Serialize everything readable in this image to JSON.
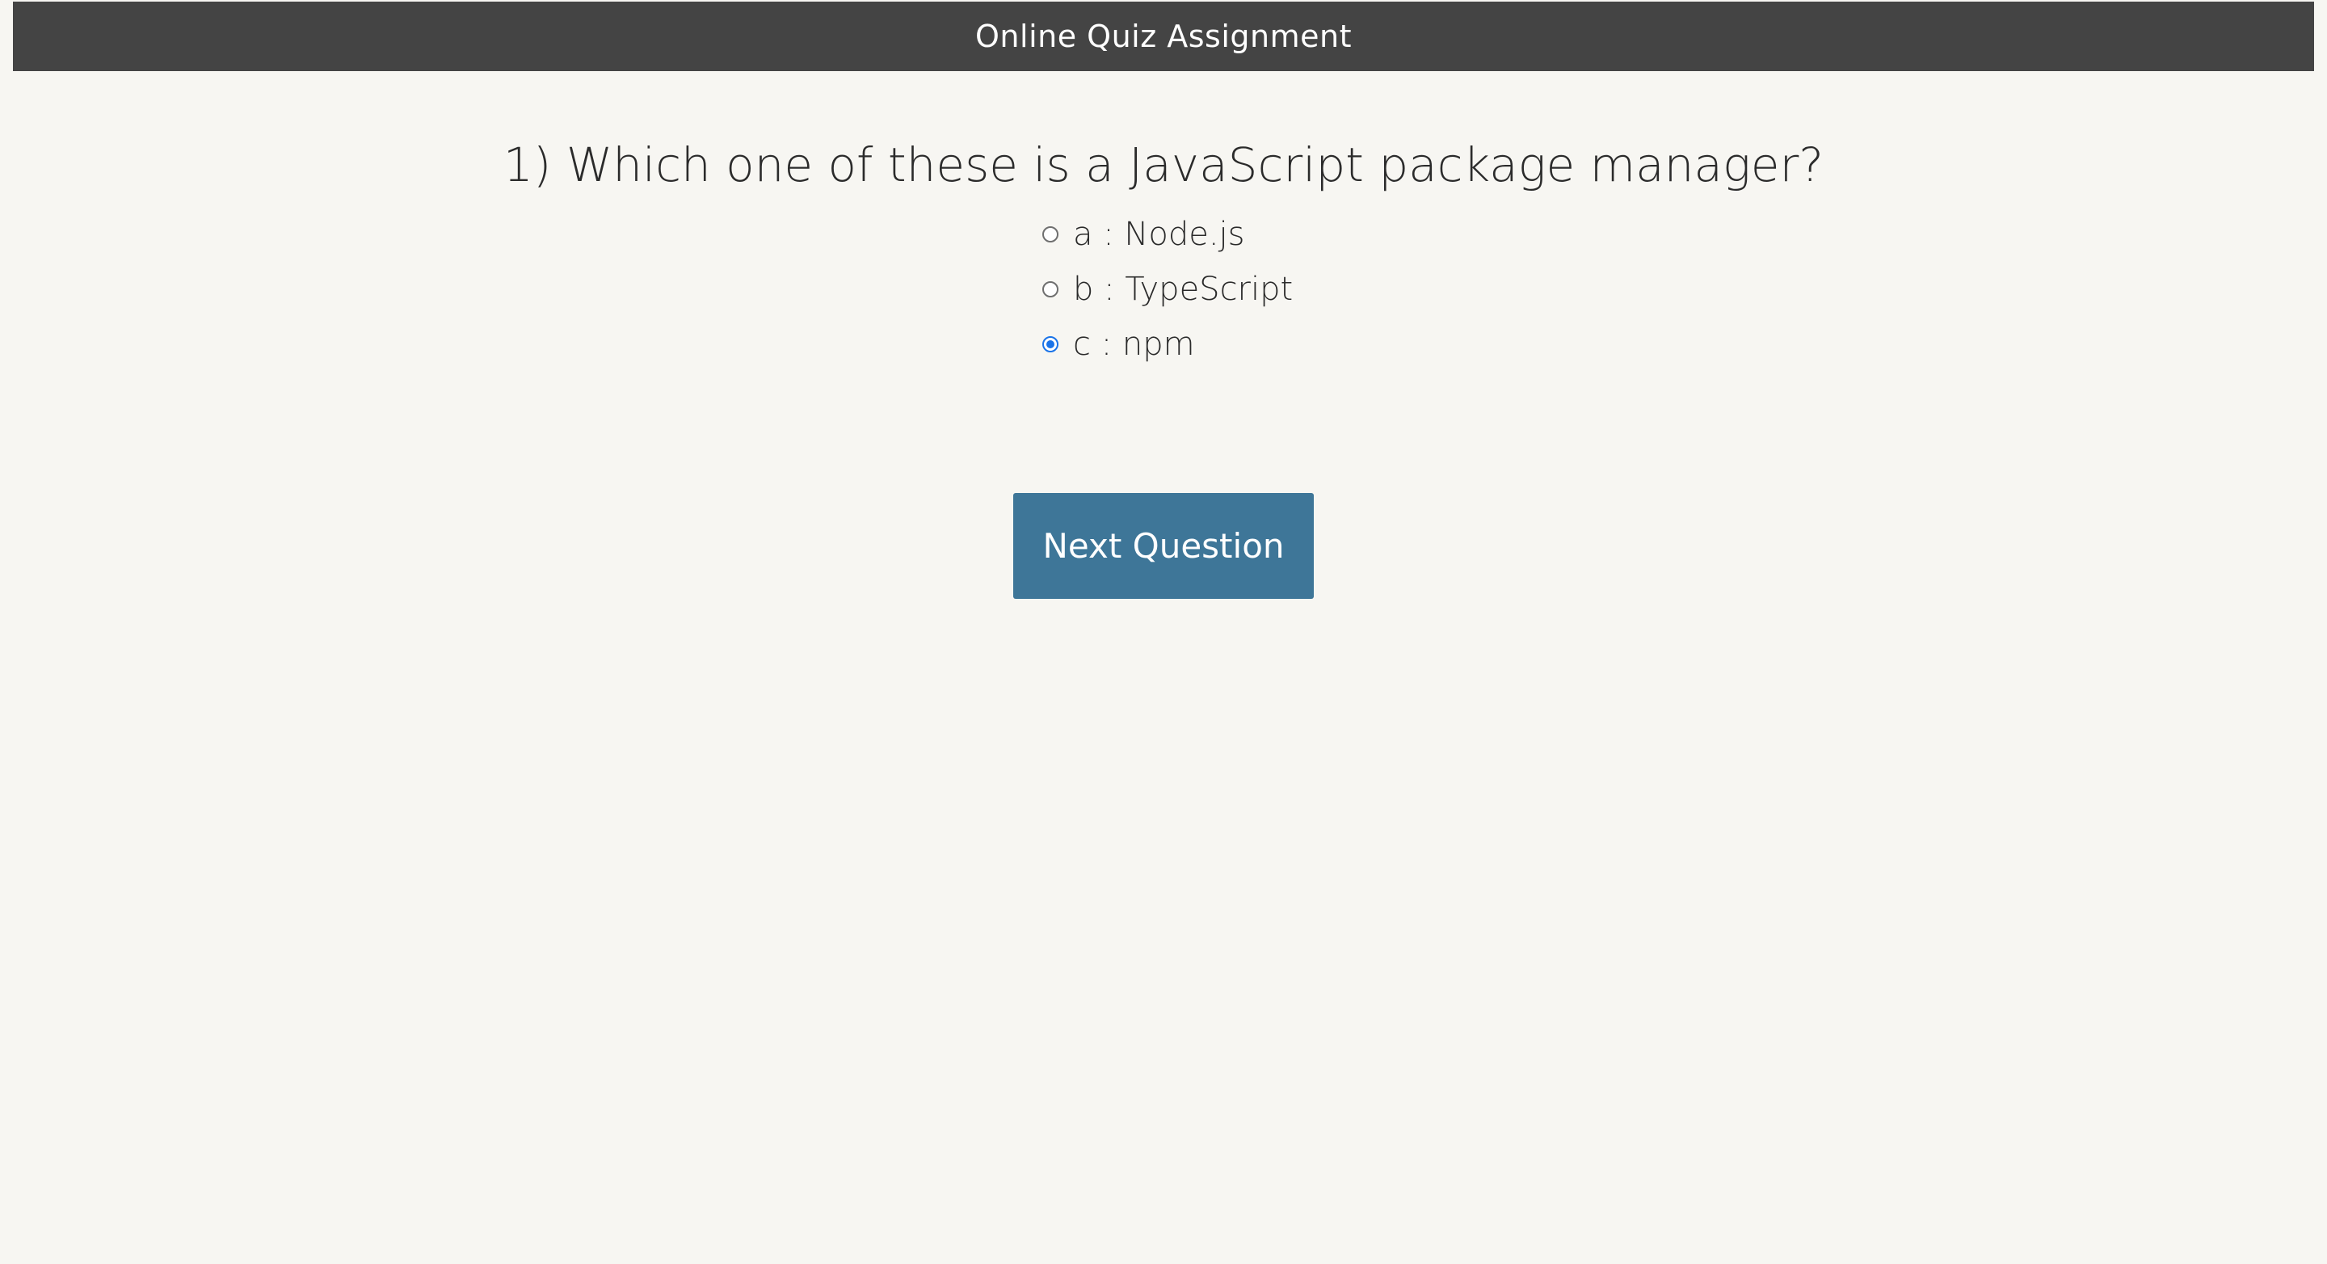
{
  "header": {
    "title": "Online Quiz Assignment"
  },
  "quiz": {
    "question": "1) Which one of these is a JavaScript package manager?",
    "options": [
      {
        "label": "a : Node.js",
        "selected": false
      },
      {
        "label": "b : TypeScript",
        "selected": false
      },
      {
        "label": "c : npm",
        "selected": true
      }
    ],
    "next_label": "Next Question"
  },
  "colors": {
    "header_bg": "#444444",
    "page_bg": "#f7f6f2",
    "button_bg": "#3e7698",
    "radio_selected": "#1a73e8"
  }
}
